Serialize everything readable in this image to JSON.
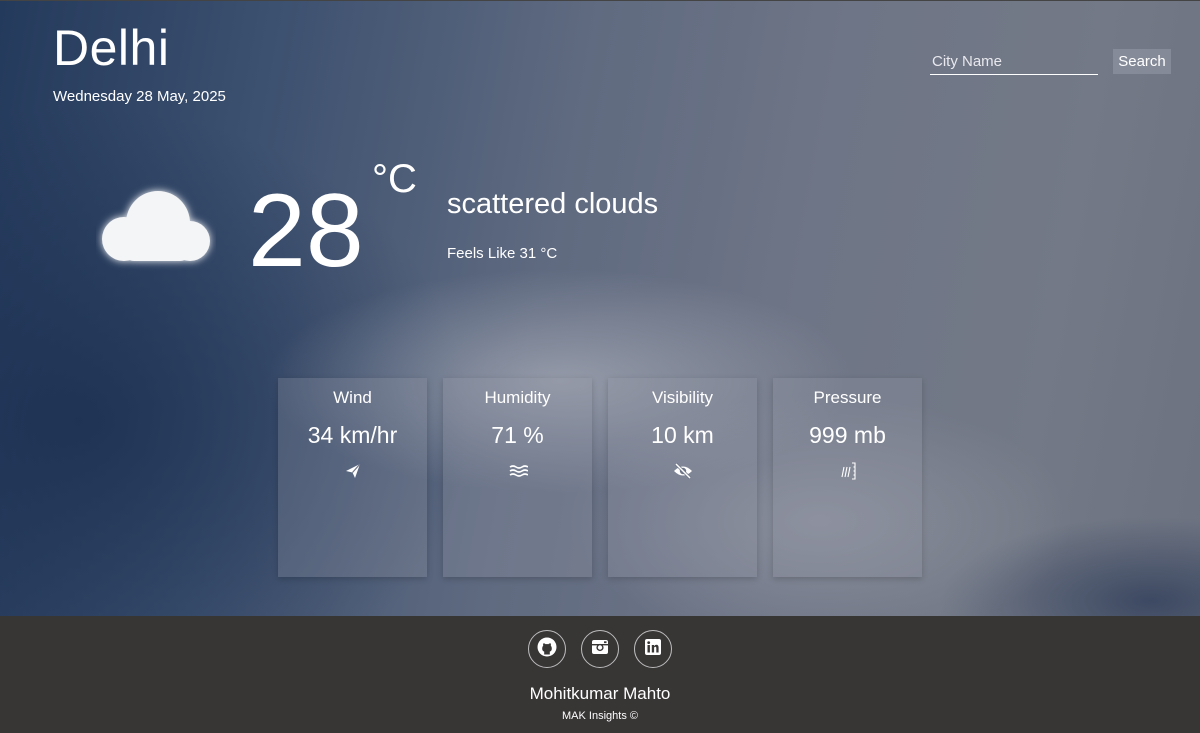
{
  "location": {
    "city": "Delhi",
    "date": "Wednesday 28 May, 2025"
  },
  "search": {
    "placeholder": "City Name",
    "value": "",
    "button_label": "Search"
  },
  "current": {
    "icon": "cloud-icon",
    "temperature": "28",
    "unit": "°C",
    "description": "scattered clouds",
    "feels_like": "Feels Like 31 °C"
  },
  "details": [
    {
      "label": "Wind",
      "value": "34 km/hr",
      "icon": "paper-plane-icon"
    },
    {
      "label": "Humidity",
      "value": "71 %",
      "icon": "water-waves-icon"
    },
    {
      "label": "Visibility",
      "value": "10 km",
      "icon": "eye-slash-icon"
    },
    {
      "label": "Pressure",
      "value": "999 mb",
      "icon": "pressure-icon"
    }
  ],
  "footer": {
    "socials": [
      {
        "name": "GitHub",
        "icon": "github-icon"
      },
      {
        "name": "Instagram",
        "icon": "instagram-icon"
      },
      {
        "name": "LinkedIn",
        "icon": "linkedin-icon"
      }
    ],
    "author": "Mohitkumar Mahto",
    "copyright": "MAK Insights ©"
  },
  "colors": {
    "footer_bg": "#383535",
    "text": "#ffffff"
  }
}
